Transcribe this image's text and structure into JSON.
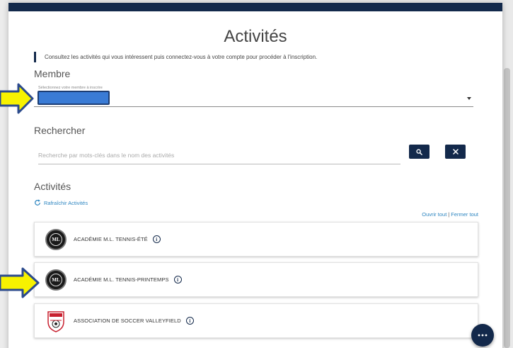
{
  "page": {
    "title": "Activités",
    "intro": "Consultez les activités qui vous intéressent puis connectez-vous à votre compte pour procéder à l'inscription."
  },
  "member": {
    "label": "Membre",
    "sublabel": "Sélectionnez votre membre à inscrire",
    "selected_value": ""
  },
  "search": {
    "label": "Rechercher",
    "placeholder": "Recherche par mots-clés dans le nom des activités",
    "value": ""
  },
  "activities": {
    "label": "Activités",
    "refresh_label": "Rafraîchir Activités",
    "open_all": "Ouvrir tout",
    "separator": "|",
    "close_all": "Fermer tout",
    "items": [
      {
        "name": "ACADÉMIE M.L. TENNIS-ÉTÉ",
        "logo": "ML"
      },
      {
        "name": "ACADÉMIE M.L. TENNIS-PRINTEMPS",
        "logo": "ML"
      },
      {
        "name": "ASSOCIATION DE SOCCER VALLEYFIELD",
        "logo": "soccer-crest"
      }
    ]
  },
  "colors": {
    "primary": "#13294b",
    "link": "#2e86c1",
    "highlight": "#3a7bd5",
    "arrow_fill": "#f7f200",
    "arrow_stroke": "#2b4a8c"
  },
  "icons": {
    "search": "search-icon",
    "clear": "close-icon",
    "refresh": "refresh-icon",
    "info": "info-icon",
    "chat": "more-icon"
  }
}
